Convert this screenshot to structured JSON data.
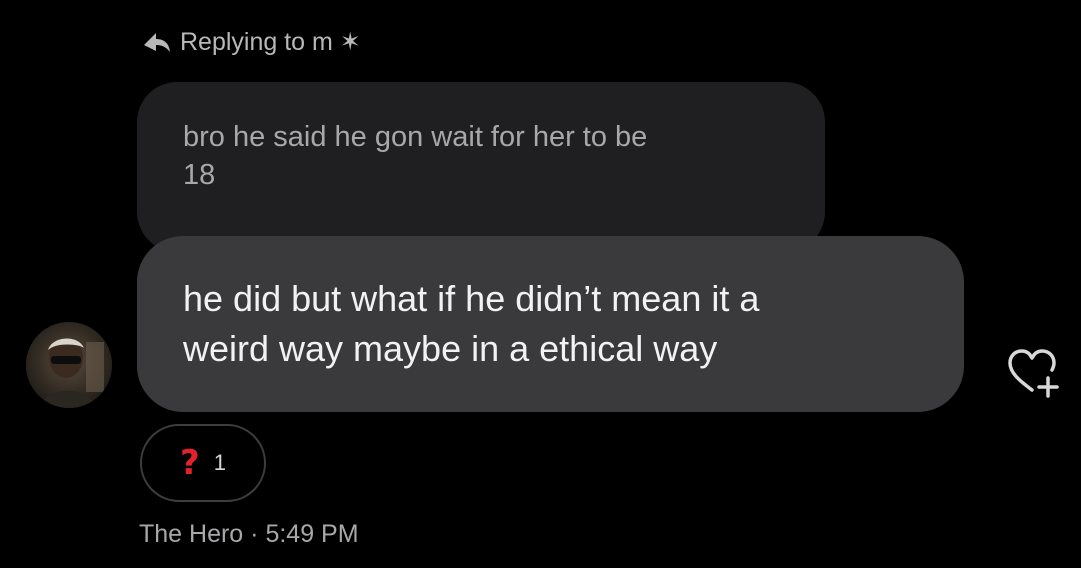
{
  "reply": {
    "icon": "reply-arrow-icon",
    "text": "Replying to m ✶"
  },
  "quoted_message": {
    "line1": "bro he said he gon wait for her to be",
    "line2": "18"
  },
  "message": {
    "line1": "he did but what if he didn’t mean it a",
    "line2": "weird way maybe in a ethical way"
  },
  "reaction": {
    "emoji": "?",
    "count": "1",
    "emoji_color": "#e0232b"
  },
  "meta": {
    "sender": "The Hero",
    "separator": " · ",
    "time": "5:49 PM"
  },
  "icons": {
    "avatar": "avatar",
    "like": "heart-plus-icon"
  }
}
